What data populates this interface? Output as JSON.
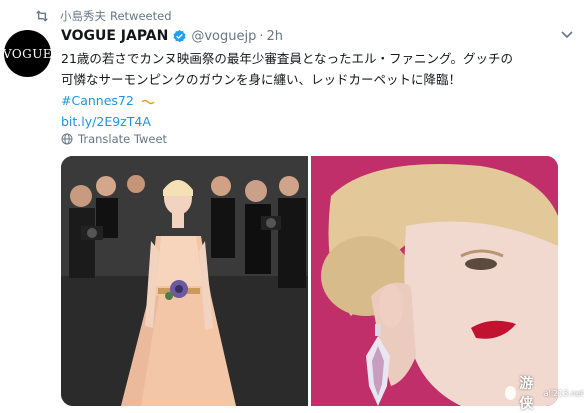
{
  "retweet": {
    "user": "小島秀夫",
    "label": "Retweeted",
    "icon": "retweet-icon"
  },
  "author": {
    "avatar_text": "VOGUE",
    "name": "VOGUE JAPAN",
    "handle": "@voguejp",
    "separator": "·",
    "time": "2h",
    "verified": true
  },
  "tweet": {
    "line1": "21歳の若さでカンヌ映画祭の最年少審査員となったエル・ファニング。グッチの",
    "line2": "可憐なサーモンピンクのガウンを身に纏い、レッドカーペットに降臨！",
    "hashtag": "#Cannes72",
    "link": "bit.ly/2E9zT4A"
  },
  "translate": {
    "label": "Translate Tweet",
    "icon": "globe-icon"
  },
  "media": {
    "photos": [
      {
        "name": "photo-red-carpet-gown"
      },
      {
        "name": "photo-earring-closeup"
      }
    ]
  },
  "watermark": {
    "text": "游侠",
    "sub": "ali213.net"
  },
  "colors": {
    "link": "#1b95e0",
    "muted": "#657786",
    "text": "#14171a",
    "verified": "#1da1f2"
  }
}
